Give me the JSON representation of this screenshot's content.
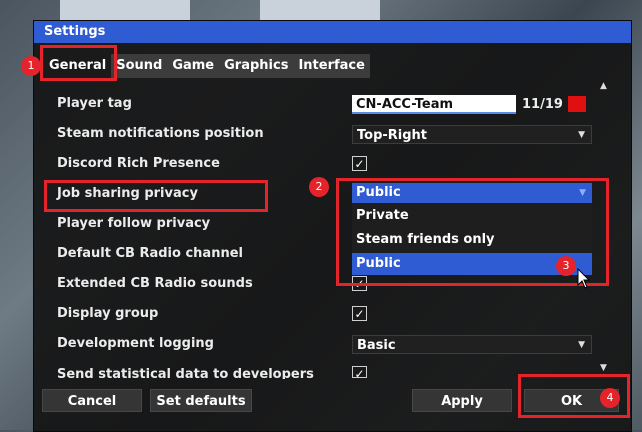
{
  "window": {
    "title": "Settings"
  },
  "tabs": [
    "General",
    "Sound",
    "Game",
    "Graphics",
    "Interface"
  ],
  "settings": {
    "player_tag": {
      "label": "Player tag",
      "value": "CN-ACC-Team",
      "counter": "11/19",
      "color": "#e01010"
    },
    "steam_notifications": {
      "label": "Steam notifications position",
      "value": "Top-Right"
    },
    "discord_rich_presence": {
      "label": "Discord Rich Presence",
      "checked": true
    },
    "job_sharing": {
      "label": "Job sharing privacy",
      "value": "Public"
    },
    "player_follow": {
      "label": "Player follow privacy"
    },
    "cb_channel": {
      "label": "Default CB Radio channel"
    },
    "extended_cb": {
      "label": "Extended CB Radio sounds",
      "checked": true
    },
    "display_group": {
      "label": "Display group",
      "checked": true
    },
    "dev_logging": {
      "label": "Development logging",
      "value": "Basic"
    },
    "stats": {
      "label": "Send statistical data to developers",
      "checked": true
    }
  },
  "dropdown": {
    "selected": "Public",
    "options": [
      "Private",
      "Steam friends only",
      "Public"
    ],
    "highlighted": "Public"
  },
  "buttons": {
    "cancel": "Cancel",
    "defaults": "Set defaults",
    "apply": "Apply",
    "ok": "OK"
  },
  "annotations": [
    "1",
    "2",
    "3",
    "4"
  ],
  "colors": {
    "accent": "#2f5bd3",
    "annotation": "#e5232b",
    "window_bg": "#141414"
  },
  "icons": {
    "check": "✓",
    "dropdown_arrow": "▼",
    "scroll_up": "▲"
  }
}
